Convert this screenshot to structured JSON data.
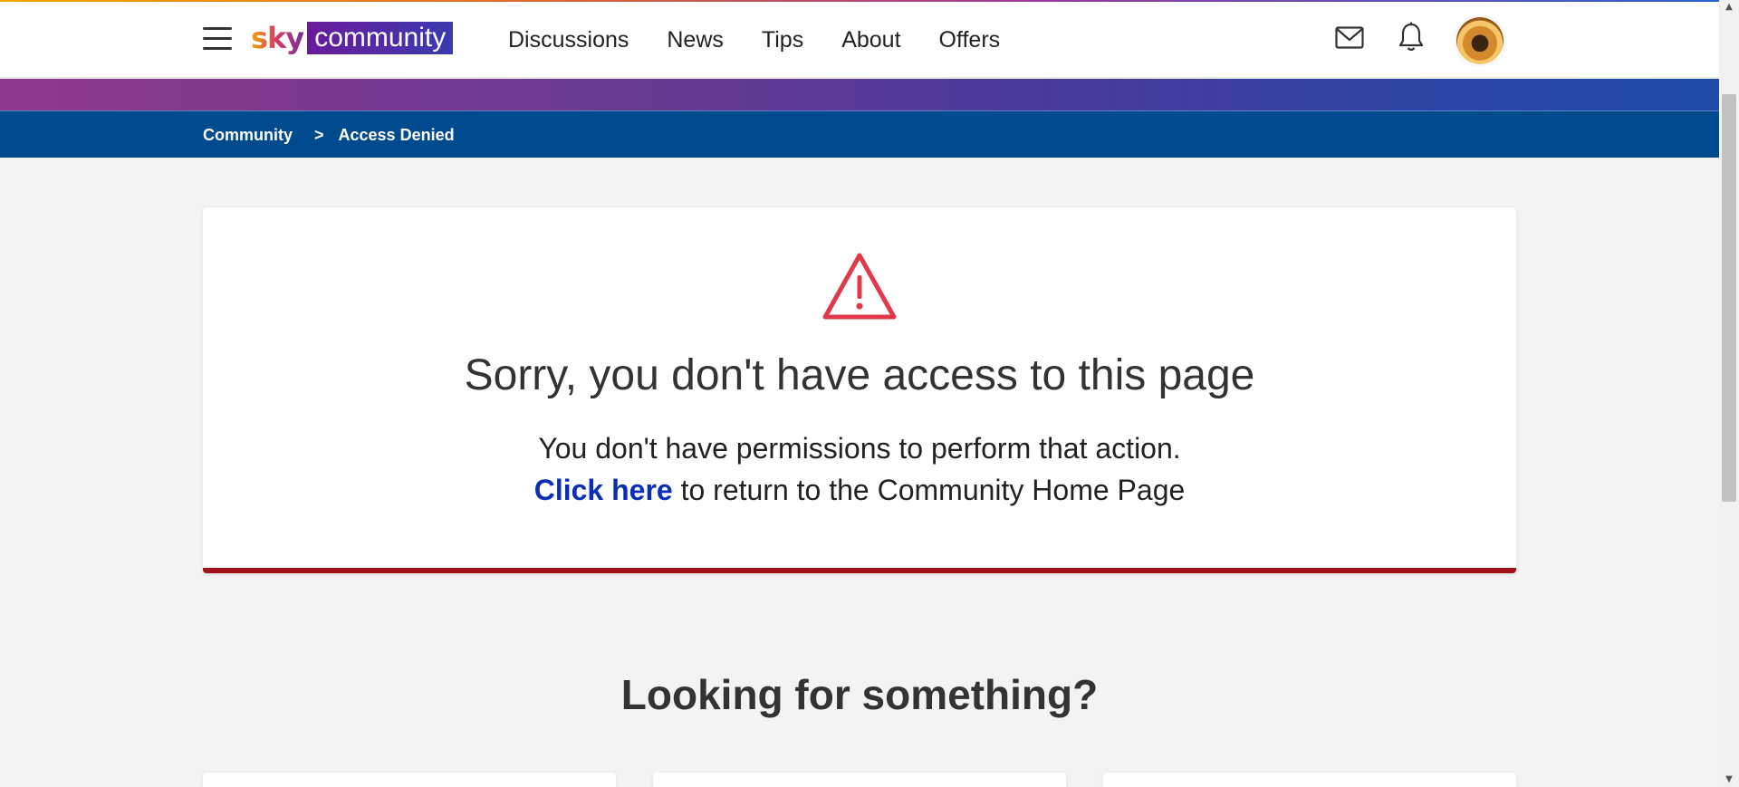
{
  "header": {
    "logo_sky": "sky",
    "logo_community": "community",
    "nav": [
      {
        "label": "Discussions"
      },
      {
        "label": "News"
      },
      {
        "label": "Tips"
      },
      {
        "label": "About"
      },
      {
        "label": "Offers"
      }
    ],
    "icons": {
      "menu": "hamburger-menu-icon",
      "mail": "mail-icon",
      "bell": "bell-icon",
      "avatar": "avatar"
    }
  },
  "breadcrumb": {
    "items": [
      {
        "label": "Community"
      },
      {
        "label": "Access Denied"
      }
    ],
    "separator": ">"
  },
  "error_card": {
    "icon": "warning-triangle-icon",
    "title": "Sorry, you don't have access to this page",
    "message": "You don't have permissions to perform that action.",
    "link_label": "Click here",
    "return_text": " to return to the Community Home Page",
    "accent_color": "#a3111b",
    "icon_color": "#e03a4a"
  },
  "looking_section": {
    "title": "Looking for something?"
  },
  "colors": {
    "breadcrumb_bg": "#004b8d",
    "link": "#0a2eb8"
  }
}
